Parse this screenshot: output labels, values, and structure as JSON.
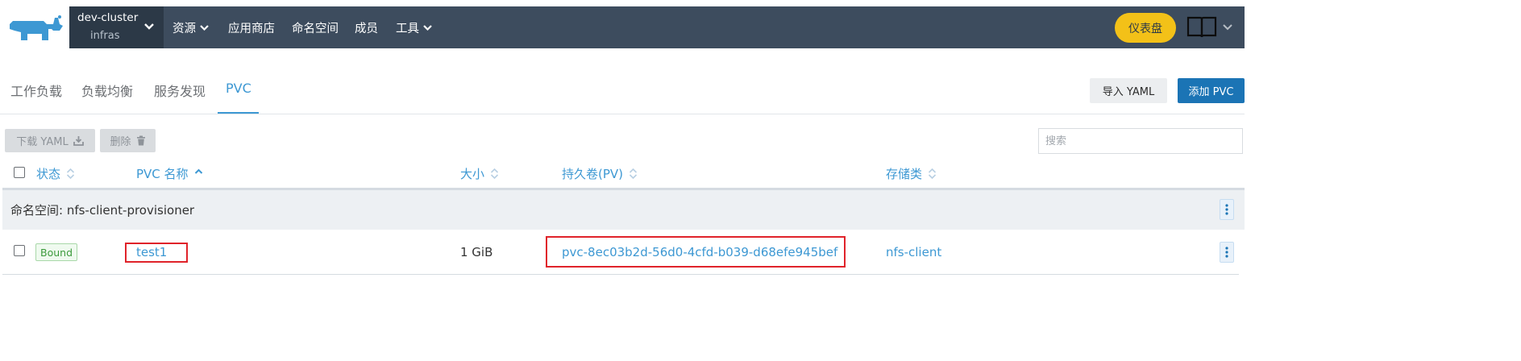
{
  "colors": {
    "topbar": "#3d4c5e",
    "accent": "#3d98d3",
    "primary_button": "#1b74b5",
    "dashboard_button": "#f3c118",
    "bound_badge": "#3c9a3c",
    "highlight_box": "#e0232a"
  },
  "header": {
    "logo_icon": "rancher-cow-icon",
    "cluster": {
      "name": "dev-cluster",
      "project": "infras"
    },
    "nav": [
      {
        "label": "资源",
        "has_menu": true
      },
      {
        "label": "应用商店",
        "has_menu": false
      },
      {
        "label": "命名空间",
        "has_menu": false
      },
      {
        "label": "成员",
        "has_menu": false
      },
      {
        "label": "工具",
        "has_menu": true
      }
    ],
    "dashboard_label": "仪表盘",
    "docs_icon": "book-icon"
  },
  "tabs": {
    "items": [
      {
        "label": "工作负载"
      },
      {
        "label": "负载均衡"
      },
      {
        "label": "服务发现"
      },
      {
        "label": "PVC",
        "active": true
      }
    ],
    "import_label": "导入 YAML",
    "add_label": "添加 PVC"
  },
  "toolbar": {
    "download_label": "下载 YAML",
    "delete_label": "删除",
    "search_placeholder": "搜索"
  },
  "table": {
    "columns": [
      {
        "label": "状态",
        "sort": "both"
      },
      {
        "label": "PVC 名称",
        "sort": "asc"
      },
      {
        "label": "大小",
        "sort": "both"
      },
      {
        "label": "持久卷(PV)",
        "sort": "both"
      },
      {
        "label": "存储类",
        "sort": "both"
      }
    ],
    "group": {
      "label": "命名空间: nfs-client-provisioner"
    },
    "rows": [
      {
        "status": "Bound",
        "name": "test1",
        "size": "1 GiB",
        "pv": "pvc-8ec03b2d-56d0-4cfd-b039-d68efe945bef",
        "storage_class": "nfs-client"
      }
    ]
  }
}
